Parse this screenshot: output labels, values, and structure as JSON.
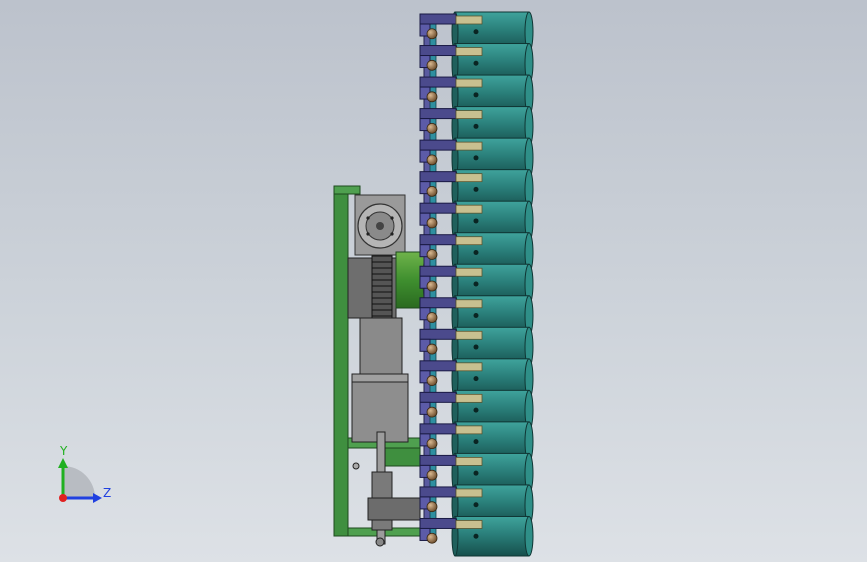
{
  "viewport": {
    "background_top": "#bcc2cc",
    "background_bottom": "#dde1e6"
  },
  "model": {
    "frame_color": "#3f8f3f",
    "housing_color": "#7e7e7e",
    "roller_color": "#2a7f7a",
    "bracket_color": "#4b4a8c",
    "shaft_color": "#2e8fa0",
    "bead_color": "#8b6b47",
    "rollers_on_screen": 17
  },
  "triad": {
    "x_label": "",
    "y_label": "Y",
    "z_label": "Z",
    "x_color": "#e02020",
    "y_color": "#20b020",
    "z_color": "#2040e0"
  }
}
